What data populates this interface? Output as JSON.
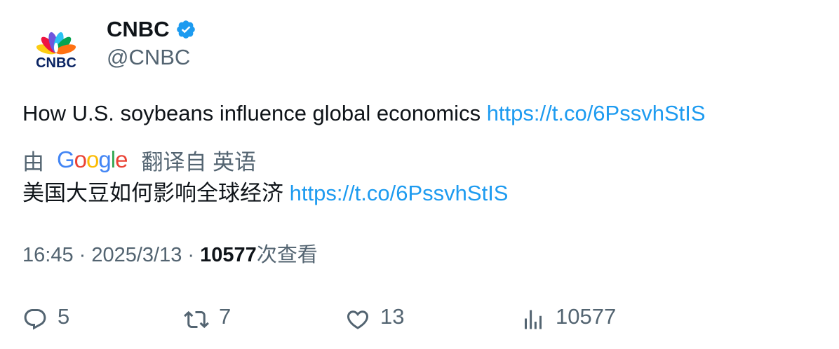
{
  "account": {
    "display_name": "CNBC",
    "handle": "@CNBC",
    "logo_text": "CNBC",
    "verified": true
  },
  "tweet": {
    "text": "How U.S. soybeans influence global economics ",
    "link": "https://t.co/6PssvhStIS"
  },
  "translation": {
    "by_label": "由",
    "provider_letters": [
      "G",
      "o",
      "o",
      "g",
      "l",
      "e"
    ],
    "from_label": "翻译自 英语",
    "text": "美国大豆如何影响全球经济 ",
    "link": "https://t.co/6PssvhStIS"
  },
  "meta": {
    "time": "16:45",
    "separator": " · ",
    "date": "2025/3/13",
    "views": "10577",
    "views_label": "次查看"
  },
  "actions": {
    "replies": "5",
    "retweets": "7",
    "likes": "13",
    "views": "10577"
  },
  "colors": {
    "link": "#1d9bf0",
    "secondary_text": "#536471",
    "primary_text": "#0f1419",
    "verified": "#1d9bf0",
    "google_blue": "#4285F4",
    "google_red": "#EA4335",
    "google_yellow": "#FBBC05",
    "google_green": "#34A853"
  }
}
